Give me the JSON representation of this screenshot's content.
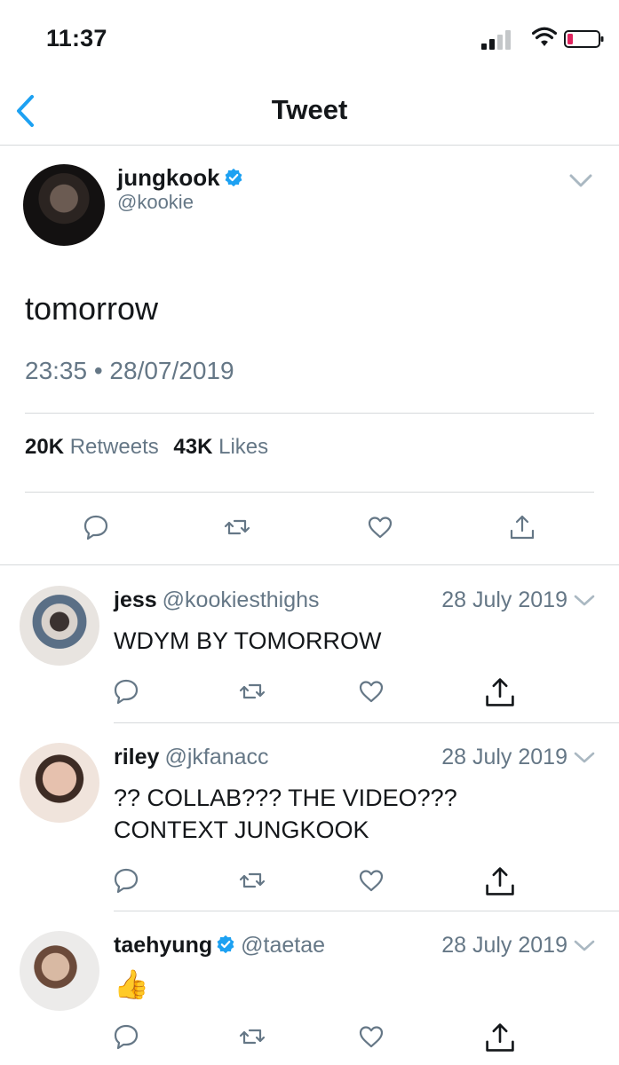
{
  "status_bar": {
    "time": "11:37"
  },
  "header": {
    "title": "Tweet"
  },
  "main_tweet": {
    "author_name": "jungkook",
    "author_handle": "@kookie",
    "text": "tomorrow",
    "timestamp": "23:35 • 28/07/2019",
    "retweets_count": "20K",
    "retweets_label": "Retweets",
    "likes_count": "43K",
    "likes_label": "Likes"
  },
  "replies": [
    {
      "name": "jess",
      "handle": "@kookiesthighs",
      "date": "28 July 2019",
      "text": "WDYM BY TOMORROW",
      "verified": false
    },
    {
      "name": "riley",
      "handle": "@jkfanacc",
      "date": "28 July 2019",
      "text": "?? COLLAB??? THE VIDEO???\nCONTEXT JUNGKOOK",
      "verified": false
    },
    {
      "name": "taehyung",
      "handle": "@taetae",
      "date": "28 July 2019",
      "text": "👍",
      "verified": true
    }
  ],
  "colors": {
    "accent": "#1da1f2",
    "secondary_text": "#657786",
    "divider": "#d6d9db",
    "battery_low": "#e0245e"
  },
  "icons": [
    "back-chevron-icon",
    "verified-badge-icon",
    "chevron-down-icon",
    "reply-icon",
    "retweet-icon",
    "like-icon",
    "share-icon",
    "signal-icon",
    "wifi-icon",
    "battery-icon"
  ]
}
